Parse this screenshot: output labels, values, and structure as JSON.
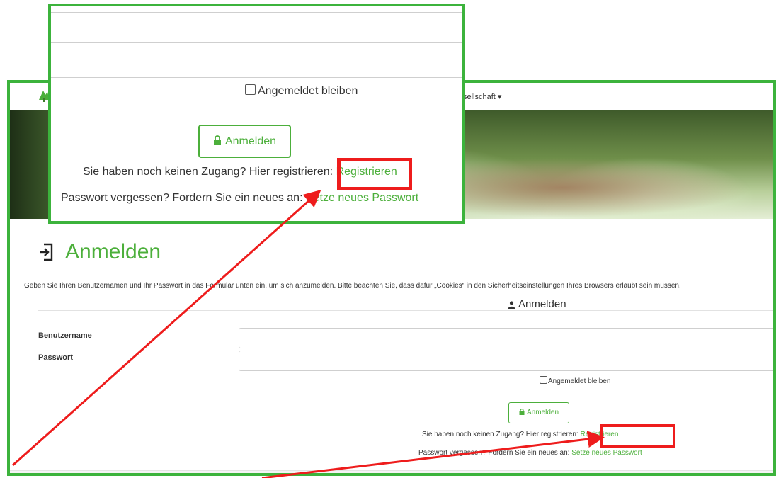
{
  "nav": {
    "item_gesellschaft": "sellschaft ▾"
  },
  "page": {
    "title": "Anmelden",
    "intro": "Geben Sie Ihren Benutzernamen und Ihr Passwort in das Formular unten ein, um sich anzumelden. Bitte beachten Sie, dass dafür „Cookies“ in den Sicherheitseinstellungen Ihres Browsers erlaubt sein müssen.",
    "section_heading": "Anmelden"
  },
  "form": {
    "username_label": "Benutzername",
    "password_label": "Passwort",
    "username_value": "",
    "password_value": "",
    "remember_label": "Angemeldet bleiben",
    "login_button": "Anmelden",
    "register_prompt": "Sie haben noch keinen Zugang? Hier registrieren:",
    "register_link": "Registrieren",
    "forgot_prompt": "Passwort vergessen? Fordern Sie ein neues an:",
    "forgot_link": "Setze neues Passwort"
  },
  "zoom": {
    "remember_label": "Angemeldet bleiben",
    "login_button": "Anmelden",
    "register_prompt": "Sie haben noch keinen Zugang? Hier registrieren:",
    "register_link": "Registrieren",
    "forgot_prompt": "Passwort vergessen? Fordern Sie ein neues an:",
    "forgot_link": "Setze neues Passwort"
  },
  "colors": {
    "accent_green": "#4caf3b",
    "frame_green": "#3cb33c",
    "highlight_red": "#ee1c1c"
  },
  "icons": {
    "logo": "tree-logo-icon",
    "title": "sign-in-icon",
    "section": "user-icon",
    "button": "lock-icon"
  }
}
